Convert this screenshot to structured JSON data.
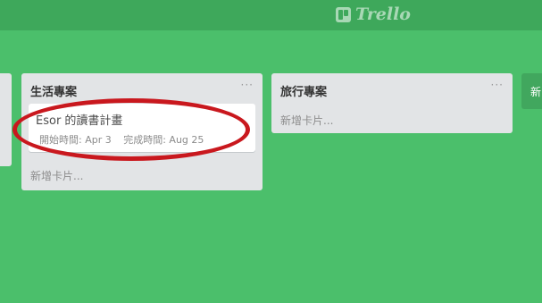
{
  "header": {
    "logo_text": "Trello"
  },
  "lists": [
    {
      "title": "生活專案",
      "menu": "···",
      "card": {
        "title": "Esor 的讀書計畫",
        "start_label": "開始時間: Apr 3",
        "end_label": "完成時間: Aug 25"
      },
      "add_card": "新增卡片..."
    },
    {
      "title": "旅行專案",
      "menu": "···",
      "add_card": "新增卡片..."
    }
  ],
  "add_list_label": "新",
  "annotation": {
    "color": "#c9181e"
  },
  "colors": {
    "board_bg": "#4bbf6b",
    "header_bg": "#3ea85b",
    "list_bg": "#e2e4e6"
  }
}
